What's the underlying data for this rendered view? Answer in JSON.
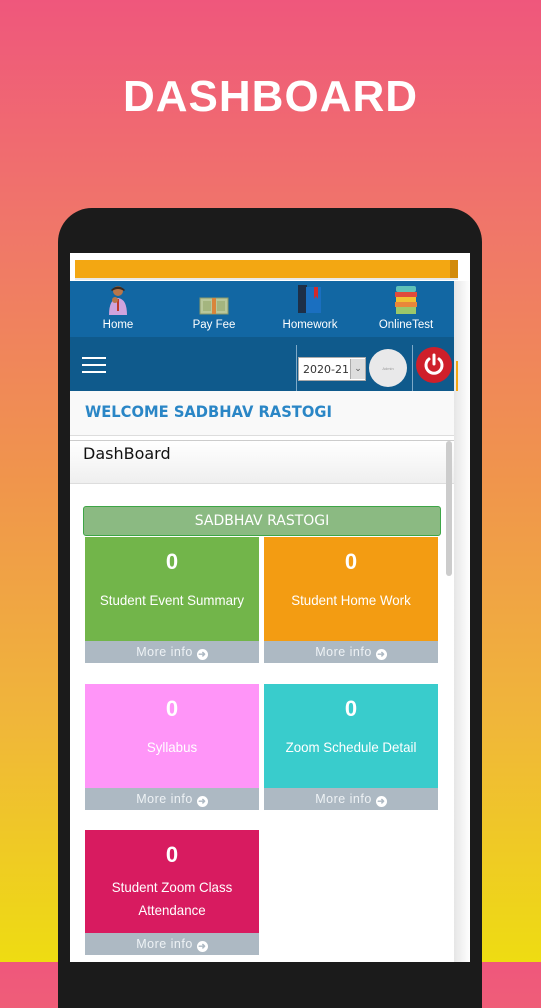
{
  "headline": "DASHBOARD",
  "top_nav": [
    {
      "label": "Home",
      "icon": "student-person-icon"
    },
    {
      "label": "Pay Fee",
      "icon": "cash-bundle-icon"
    },
    {
      "label": "Homework",
      "icon": "books-icon"
    },
    {
      "label": "OnlineTest",
      "icon": "stacked-books-icon"
    }
  ],
  "toolbar": {
    "menu_icon": "hamburger-icon",
    "session_year": "2020-21",
    "avatar_text": "Admin",
    "logout_icon": "power-icon"
  },
  "welcome": "WELCOME SADBHAV RASTOGI",
  "page_heading": "DashBoard",
  "student_name": "SADBHAV RASTOGI",
  "tiles": [
    {
      "count": "0",
      "label": "Student Event Summary",
      "more": "More info",
      "color": "#72b54a"
    },
    {
      "count": "0",
      "label": "Student Home Work",
      "more": "More info",
      "color": "#f39c12"
    },
    {
      "count": "0",
      "label": "Syllabus",
      "more": "More info",
      "color": "#ff95f8"
    },
    {
      "count": "0",
      "label": "Zoom Schedule Detail",
      "more": "More info",
      "color": "#39cccc"
    },
    {
      "count": "0",
      "label": "Student Zoom Class Attendance",
      "more": "More info",
      "color": "#d81b60"
    }
  ],
  "colors": {
    "nav_bg": "#1267a3",
    "toolbar_bg": "#0f5a8c",
    "accent_orange": "#f3a712",
    "welcome_text": "#2a86c6"
  }
}
